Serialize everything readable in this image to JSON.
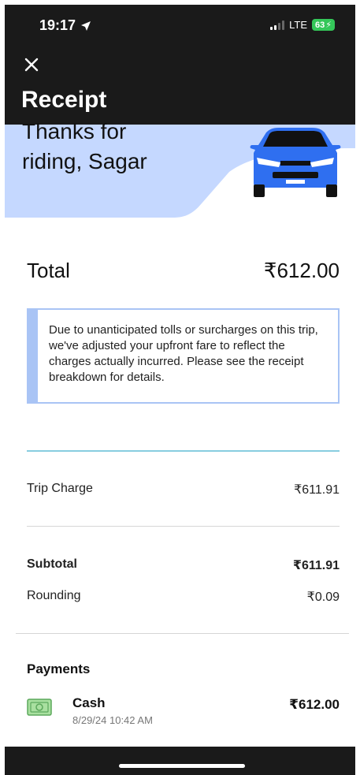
{
  "status_bar": {
    "time": "19:17",
    "network": "LTE",
    "battery": "63"
  },
  "header": {
    "close_icon": "close-icon",
    "title": "Receipt"
  },
  "hero": {
    "line1": "Thanks for",
    "line2": "riding, Sagar",
    "accent_color": "#c5d8ff",
    "car_color": "#2f6ff0"
  },
  "total": {
    "label": "Total",
    "value": "₹612.00"
  },
  "notice": {
    "text": "Due to unanticipated tolls or surcharges on this trip, we've adjusted your upfront fare to reflect the charges actually incurred. Please see the receipt breakdown for details."
  },
  "breakdown": {
    "trip_charge_label": "Trip Charge",
    "trip_charge_value": "₹611.91",
    "subtotal_label": "Subtotal",
    "subtotal_value": "₹611.91",
    "rounding_label": "Rounding",
    "rounding_value": "₹0.09"
  },
  "payments": {
    "title": "Payments",
    "method": "Cash",
    "datetime": "8/29/24 10:42 AM",
    "amount": "₹612.00",
    "icon": "cash-icon"
  }
}
